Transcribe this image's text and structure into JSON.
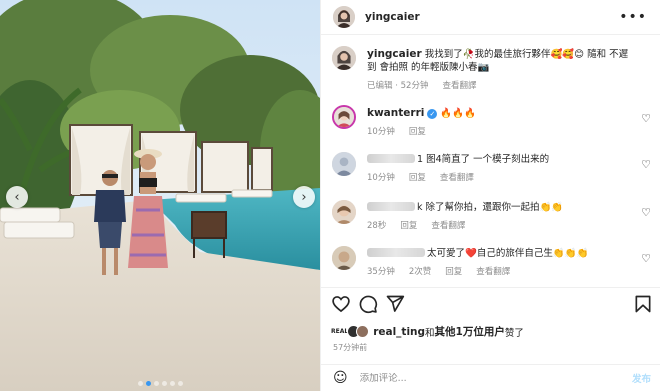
{
  "post": {
    "username": "yingcaier",
    "more_icon": "more-horizontal-icon",
    "nav_prev_icon": "chevron-left-icon",
    "nav_next_icon": "chevron-right-icon",
    "carousel": {
      "slides": 6,
      "active": 1
    }
  },
  "caption": {
    "username": "yingcaier",
    "text": "我找到了🥀我的最佳旅行夥伴🥰🥰😊 隨和 不遲到 會拍照 的年輕版陳小春📷",
    "edited": "已编辑",
    "time": "52分钟",
    "translate": "查看翻譯"
  },
  "comments": [
    {
      "username": "kwanterri",
      "verified": true,
      "text": "🔥🔥🔥",
      "time": "10分钟",
      "reply": "回复",
      "translate": ""
    },
    {
      "username": "",
      "text": "1 图4简直了 一个模子刻出来的",
      "time": "10分钟",
      "reply": "回复",
      "translate": "查看翻譯"
    },
    {
      "username": "",
      "text": "k 除了幫你拍，還跟你一起拍👏👏",
      "time": "28秒",
      "reply": "回复",
      "translate": "查看翻譯"
    },
    {
      "username": "",
      "text": "太可愛了❤️自己的旅伴自己生👏👏👏",
      "time": "35分钟",
      "reply": "2次赞",
      "translate": "回复",
      "extra": "查看翻譯"
    }
  ],
  "actions": {
    "like_icon": "heart-icon",
    "comment_icon": "comment-icon",
    "share_icon": "send-icon",
    "save_icon": "bookmark-icon"
  },
  "likes": {
    "badge": "REAL",
    "user": "real_ting",
    "connector": "和",
    "others": "其他1万位用户",
    "suffix": "赞了"
  },
  "posted_ago": "57分钟前",
  "add_comment": {
    "emoji_icon": "emoji-icon",
    "placeholder": "添加评论...",
    "post_label": "发布"
  },
  "colors": {
    "accent": "#0095f6",
    "muted": "#8e8e8e",
    "verified": "#3897f0",
    "heart_red": "#ed4956"
  }
}
